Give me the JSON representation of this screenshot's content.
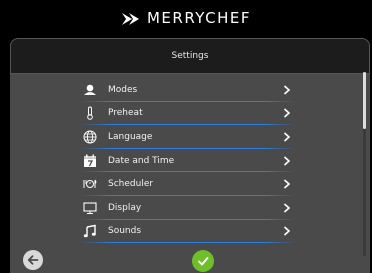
{
  "brand": {
    "name": "MERRYCHEF",
    "logo_icon": "merrychef-logo-icon"
  },
  "screen": {
    "title": "Settings"
  },
  "menu": {
    "items": [
      {
        "label": "Modes",
        "icon": "chef-hat-icon"
      },
      {
        "label": "Preheat",
        "icon": "thermometer-icon"
      },
      {
        "label": "Language",
        "icon": "globe-icon"
      },
      {
        "label": "Date and Time",
        "icon": "calendar-icon"
      },
      {
        "label": "Scheduler",
        "icon": "scheduler-icon"
      },
      {
        "label": "Display",
        "icon": "monitor-icon"
      },
      {
        "label": "Sounds",
        "icon": "music-note-icon"
      }
    ]
  },
  "colors": {
    "panel": "#4a4a4a",
    "separator": "#2f7fe0",
    "confirm": "#6fbf2a"
  },
  "scroll": {
    "position_fraction": 0.0,
    "visible_fraction": 0.31
  }
}
